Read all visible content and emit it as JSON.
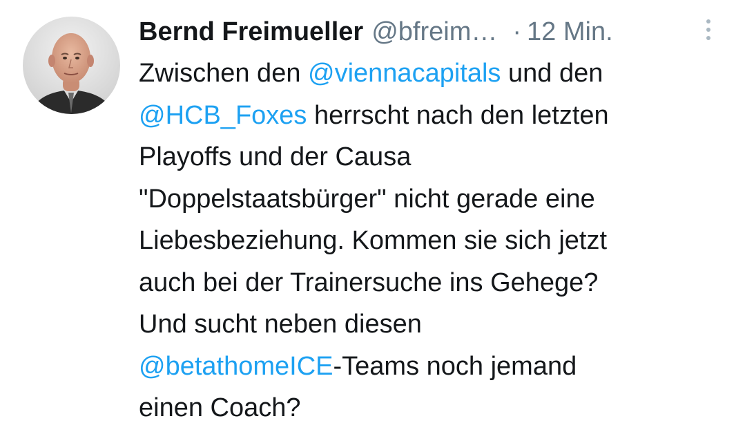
{
  "tweet": {
    "author_name": "Bernd Freimueller",
    "author_handle": "@bfreim…",
    "separator": "·",
    "timestamp": "12 Min.",
    "more_icon": "more-vertical-icon",
    "avatar_icon": "profile-photo",
    "mention_color": "#1da1f2",
    "text_lines": [
      [
        {
          "text": "Zwischen den "
        },
        {
          "text": "@viennacapitals",
          "mention": true
        },
        {
          "text": " und den"
        }
      ],
      [
        {
          "text": "@HCB_Foxes",
          "mention": true
        },
        {
          "text": " herrscht nach den letzten"
        }
      ],
      [
        {
          "text": "Playoffs und der Causa"
        }
      ],
      [
        {
          "text": "\"Doppelstaatsbürger\" nicht gerade eine"
        }
      ],
      [
        {
          "text": "Liebesbeziehung. Kommen sie sich jetzt"
        }
      ],
      [
        {
          "text": "auch bei der Trainersuche ins Gehege?"
        }
      ],
      [
        {
          "text": "Und sucht neben diesen"
        }
      ],
      [
        {
          "text": "@betathomeICE",
          "mention": true
        },
        {
          "text": "-Teams noch jemand"
        }
      ],
      [
        {
          "text": "einen Coach?"
        }
      ]
    ]
  }
}
